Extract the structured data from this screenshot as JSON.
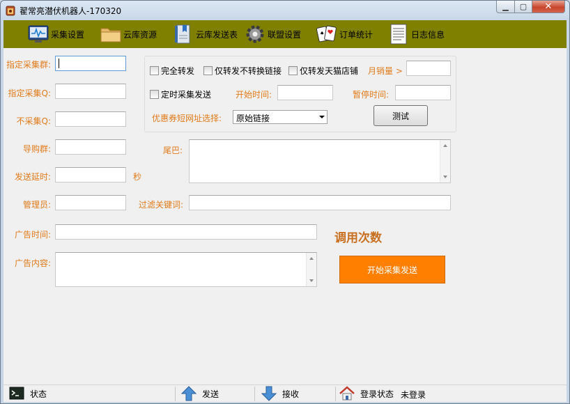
{
  "window": {
    "title": "翟常亮潜伏机器人-170320",
    "controls": {
      "minimize": "▁",
      "maximize": "▢",
      "close": "✕"
    }
  },
  "toolbar": {
    "background": "#808000",
    "items": [
      {
        "label": "采集设置",
        "icon": "monitor-icon"
      },
      {
        "label": "云库资源",
        "icon": "folder-icon"
      },
      {
        "label": "云库发送表",
        "icon": "book-icon"
      },
      {
        "label": "联盟设置",
        "icon": "gear-icon"
      },
      {
        "label": "订单统计",
        "icon": "cards-icon"
      },
      {
        "label": "日志信息",
        "icon": "document-icon"
      }
    ]
  },
  "form": {
    "label_color": "#e07b1a",
    "designated_group_label": "指定采集群:",
    "designated_group_value": "",
    "designated_q_label": "指定采集Q:",
    "designated_q_value": "",
    "exclude_q_label": "不采集Q:",
    "exclude_q_value": "",
    "shopping_group_label": "导购群:",
    "shopping_group_value": "",
    "send_delay_label": "发送延时:",
    "send_delay_value": "",
    "send_delay_unit": "秒",
    "admin_label": "管理员:",
    "admin_value": "",
    "tail_label": "尾巴:",
    "tail_value": "",
    "filter_keywords_label": "过滤关键词:",
    "filter_keywords_value": "",
    "ad_time_label": "广告时间:",
    "ad_time_value": "",
    "ad_content_label": "广告内容:",
    "ad_content_value": ""
  },
  "options": {
    "full_forward": {
      "label": "完全转发",
      "checked": false
    },
    "forward_no_convert": {
      "label": "仅转发不转换链接",
      "checked": false
    },
    "forward_tmall_only": {
      "label": "仅转发天猫店铺",
      "checked": false
    },
    "monthly_sales_label": "月销量 >",
    "monthly_sales_value": "",
    "timed_send": {
      "label": "定时采集发送",
      "checked": false
    },
    "start_time_label": "开始时间:",
    "start_time_value": "",
    "pause_time_label": "暂停时间:",
    "pause_time_value": "",
    "coupon_url_label": "优惠券短网址选择:",
    "coupon_url_selected": "原始链接",
    "test_button": "测试"
  },
  "usage_label": "调用次数",
  "start_button": {
    "label": "开始采集发送",
    "color": "#ff8000"
  },
  "statusbar": {
    "status_label": "状态",
    "send_label": "发送",
    "receive_label": "接收",
    "login_label": "登录状态",
    "login_value": "未登录"
  }
}
